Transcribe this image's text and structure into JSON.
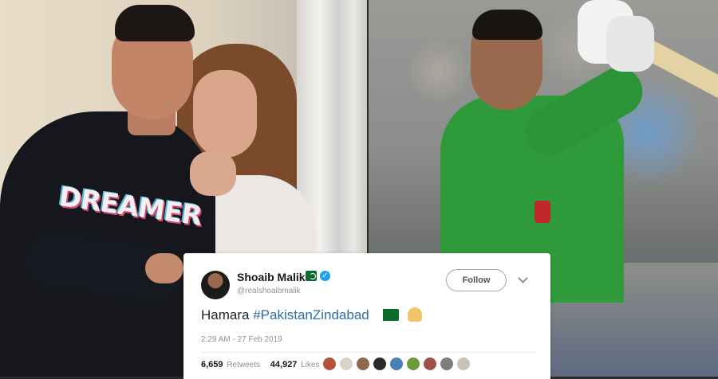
{
  "photo_left": {
    "shirt_text": "DREAMER"
  },
  "tweet": {
    "name": "Shoaib Malik",
    "handle": "@realshoaibmalik",
    "follow_label": "Follow",
    "text_prefix": "Hamara",
    "hashtag": "#PakistanZindabad",
    "timestamp": "2:29 AM - 27 Feb 2019",
    "retweets_count": "6,659",
    "retweets_label": "Retweets",
    "likes_count": "44,927",
    "likes_label": "Likes",
    "liker_avatar_colors": [
      "#b5523a",
      "#d9d3c7",
      "#8d6b4a",
      "#2b2b2b",
      "#4a7fb5",
      "#6c9a3a",
      "#a0524a",
      "#7d7d7d",
      "#c9c2b5"
    ]
  },
  "colors": {
    "verified": "#1da1f2",
    "hashtag": "#2a6fa8",
    "card": "#ffffff"
  }
}
